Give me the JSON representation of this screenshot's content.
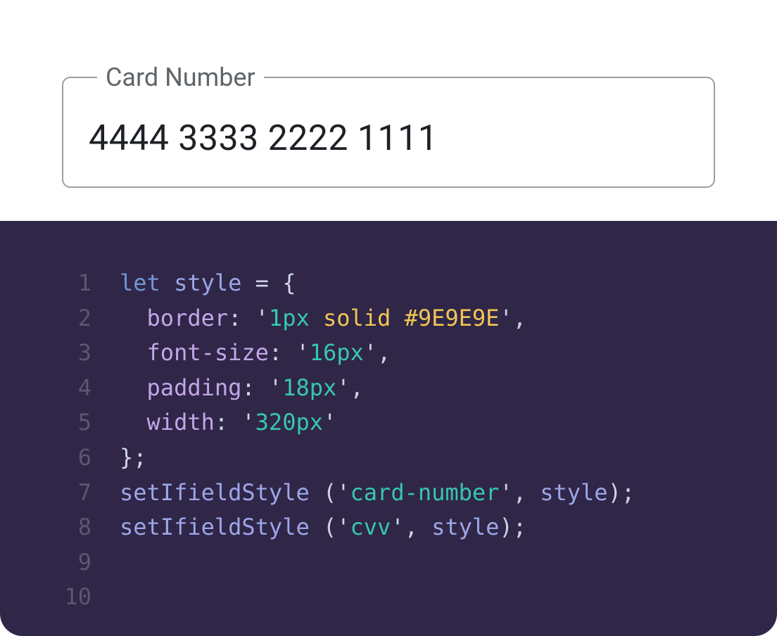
{
  "field": {
    "label": "Card Number",
    "value": "4444 3333 2222 1111"
  },
  "code": {
    "lines": [
      [
        {
          "t": "kw",
          "v": "let"
        },
        {
          "t": "punc",
          "v": " "
        },
        {
          "t": "var",
          "v": "style"
        },
        {
          "t": "punc",
          "v": " = {"
        }
      ],
      [
        {
          "t": "punc",
          "v": "  "
        },
        {
          "t": "prop",
          "v": "border"
        },
        {
          "t": "punc",
          "v": ": "
        },
        {
          "t": "quote",
          "v": "'"
        },
        {
          "t": "num",
          "v": "1"
        },
        {
          "t": "unit",
          "v": "px"
        },
        {
          "t": "punc",
          "v": " "
        },
        {
          "t": "word",
          "v": "solid"
        },
        {
          "t": "punc",
          "v": " "
        },
        {
          "t": "hex",
          "v": "#9E9E9E"
        },
        {
          "t": "quote",
          "v": "'"
        },
        {
          "t": "punc",
          "v": ","
        }
      ],
      [
        {
          "t": "punc",
          "v": "  "
        },
        {
          "t": "prop",
          "v": "font-size"
        },
        {
          "t": "punc",
          "v": ": "
        },
        {
          "t": "quote",
          "v": "'"
        },
        {
          "t": "num",
          "v": "16"
        },
        {
          "t": "unit",
          "v": "px"
        },
        {
          "t": "quote",
          "v": "'"
        },
        {
          "t": "punc",
          "v": ","
        }
      ],
      [
        {
          "t": "punc",
          "v": "  "
        },
        {
          "t": "prop",
          "v": "padding"
        },
        {
          "t": "punc",
          "v": ": "
        },
        {
          "t": "quote",
          "v": "'"
        },
        {
          "t": "num",
          "v": "18"
        },
        {
          "t": "unit",
          "v": "px"
        },
        {
          "t": "quote",
          "v": "'"
        },
        {
          "t": "punc",
          "v": ","
        }
      ],
      [
        {
          "t": "punc",
          "v": "  "
        },
        {
          "t": "prop",
          "v": "width"
        },
        {
          "t": "punc",
          "v": ": "
        },
        {
          "t": "quote",
          "v": "'"
        },
        {
          "t": "num",
          "v": "320"
        },
        {
          "t": "unit",
          "v": "px"
        },
        {
          "t": "quote",
          "v": "'"
        }
      ],
      [
        {
          "t": "punc",
          "v": "};"
        }
      ],
      [
        {
          "t": "fn",
          "v": "setIfieldStyle"
        },
        {
          "t": "punc",
          "v": " ("
        },
        {
          "t": "quote",
          "v": "'"
        },
        {
          "t": "str",
          "v": "card-number"
        },
        {
          "t": "quote",
          "v": "'"
        },
        {
          "t": "punc",
          "v": ", "
        },
        {
          "t": "var",
          "v": "style"
        },
        {
          "t": "punc",
          "v": ");"
        }
      ],
      [
        {
          "t": "fn",
          "v": "setIfieldStyle"
        },
        {
          "t": "punc",
          "v": " ("
        },
        {
          "t": "quote",
          "v": "'"
        },
        {
          "t": "str",
          "v": "cvv"
        },
        {
          "t": "quote",
          "v": "'"
        },
        {
          "t": "punc",
          "v": ", "
        },
        {
          "t": "var",
          "v": "style"
        },
        {
          "t": "punc",
          "v": ");"
        }
      ],
      [],
      []
    ]
  }
}
